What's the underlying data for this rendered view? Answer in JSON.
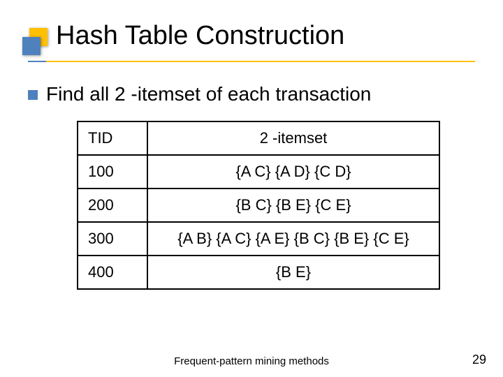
{
  "title": "Hash Table Construction",
  "bullet": "Find all 2 -itemset of each transaction",
  "table": {
    "headers": {
      "tid": "TID",
      "itemset": "2 -itemset"
    },
    "rows": [
      {
        "tid": "100",
        "itemset": "{A C} {A D} {C D}"
      },
      {
        "tid": "200",
        "itemset": "{B C} {B E} {C E}"
      },
      {
        "tid": "300",
        "itemset": "{A B} {A C} {A E} {B C} {B E} {C E}"
      },
      {
        "tid": "400",
        "itemset": "{B E}"
      }
    ]
  },
  "footer": "Frequent-pattern mining methods",
  "page": "29"
}
